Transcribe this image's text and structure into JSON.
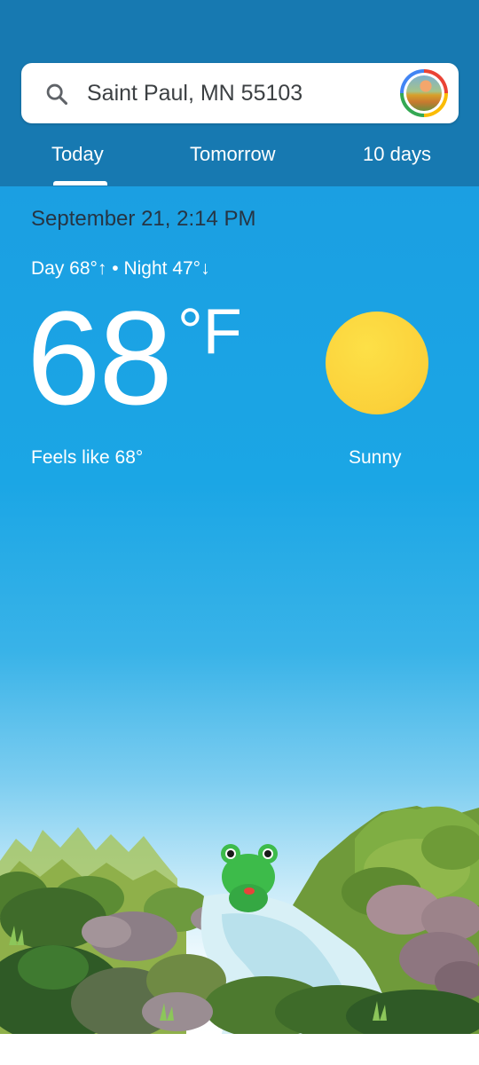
{
  "search": {
    "location": "Saint Paul, MN 55103",
    "icon": "search-icon"
  },
  "account": {
    "icon": "account-avatar"
  },
  "tabs": [
    {
      "label": "Today",
      "selected": true
    },
    {
      "label": "Tomorrow",
      "selected": false
    },
    {
      "label": "10 days",
      "selected": false
    }
  ],
  "weather": {
    "datetime": "September 21, 2:14 PM",
    "day_night": "Day 68°↑ • Night 47°↓",
    "temperature": "68",
    "unit": "°F",
    "feels_like": "Feels like 68°",
    "condition": "Sunny",
    "condition_icon": "sun-icon"
  },
  "colors": {
    "header": "#1779b1",
    "sky": "#1ba6e5",
    "sun": "#fbd13a"
  }
}
